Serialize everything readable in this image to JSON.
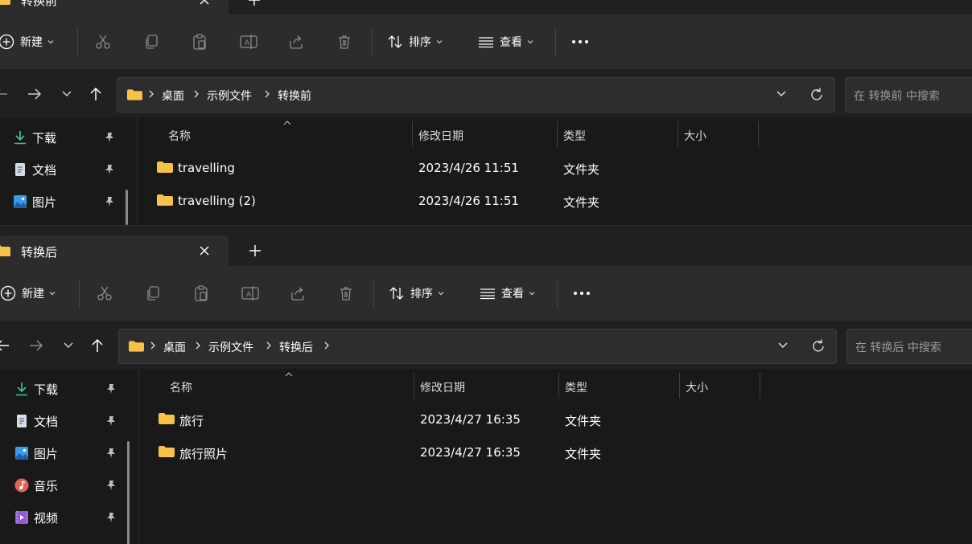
{
  "colors": {
    "accent": "#60cdff",
    "folder": "#f8c24a",
    "bg": "#191919",
    "toolbar": "#2c2c2c"
  },
  "toolbar": {
    "new_label": "新建",
    "sort_label": "排序",
    "view_label": "查看",
    "icons": [
      "cut-icon",
      "copy-icon",
      "paste-icon",
      "rename-icon",
      "share-icon",
      "delete-icon",
      "more-icon"
    ]
  },
  "columns": {
    "name": "名称",
    "modified": "修改日期",
    "type": "类型",
    "size": "大小"
  },
  "sidebar": {
    "items": [
      {
        "label": "下载",
        "icon": "download-icon"
      },
      {
        "label": "文档",
        "icon": "document-icon"
      },
      {
        "label": "图片",
        "icon": "pictures-icon"
      },
      {
        "label": "音乐",
        "icon": "music-icon"
      },
      {
        "label": "视频",
        "icon": "video-icon"
      }
    ]
  },
  "windows": [
    {
      "tab_title": "转换前",
      "breadcrumb": [
        "桌面",
        "示例文件",
        "转换前"
      ],
      "search_placeholder": "在 转换前 中搜索",
      "files": [
        {
          "name": "travelling",
          "modified": "2023/4/26 11:51",
          "type": "文件夹"
        },
        {
          "name": "travelling (2)",
          "modified": "2023/4/26 11:51",
          "type": "文件夹"
        }
      ]
    },
    {
      "tab_title": "转换后",
      "breadcrumb": [
        "桌面",
        "示例文件",
        "转换后"
      ],
      "search_placeholder": "在 转换后 中搜索",
      "files": [
        {
          "name": "旅行",
          "modified": "2023/4/27 16:35",
          "type": "文件夹"
        },
        {
          "name": "旅行照片",
          "modified": "2023/4/27 16:35",
          "type": "文件夹"
        }
      ]
    }
  ]
}
